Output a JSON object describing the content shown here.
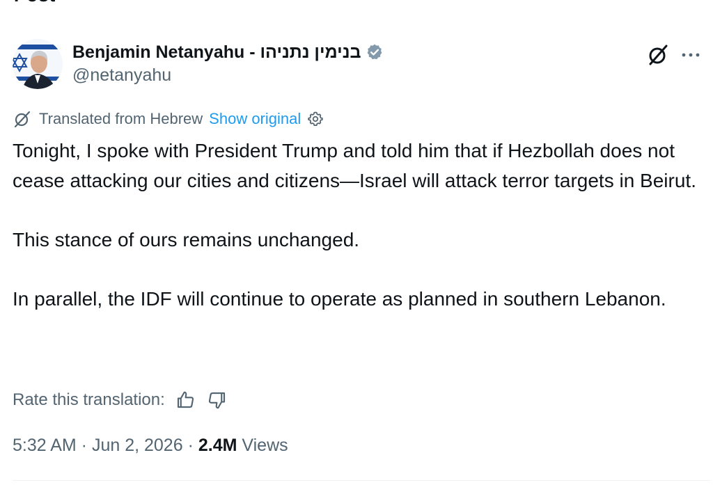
{
  "topbar": {
    "title_fragment": "Post"
  },
  "author": {
    "display_name": "Benjamin Netanyahu - בנימין נתניהו",
    "handle": "@netanyahu",
    "verified_badge_color": "#829aab"
  },
  "header_actions": {
    "grok_icon": "grok-icon",
    "more_icon": "more-icon"
  },
  "translation": {
    "label": "Translated from Hebrew",
    "show_original": "Show original"
  },
  "tweet": {
    "paragraph_1": "Tonight, I spoke with President Trump and told him that if Hezbollah does not cease attacking our cities and citizens—Israel will attack terror targets in Beirut.",
    "paragraph_2": "This stance of ours remains unchanged.",
    "paragraph_3": "In parallel, the IDF will continue to operate as planned in southern Lebanon."
  },
  "rate": {
    "label": "Rate this translation:"
  },
  "meta": {
    "time": "5:32 AM",
    "separator": " · ",
    "date": "Jun 2, 2026",
    "views_count": "2.4M",
    "views_label": "Views"
  },
  "colors": {
    "text_primary": "#0f1419",
    "text_secondary": "#536471",
    "link": "#1d9bf0",
    "divider": "#eff3f4"
  }
}
